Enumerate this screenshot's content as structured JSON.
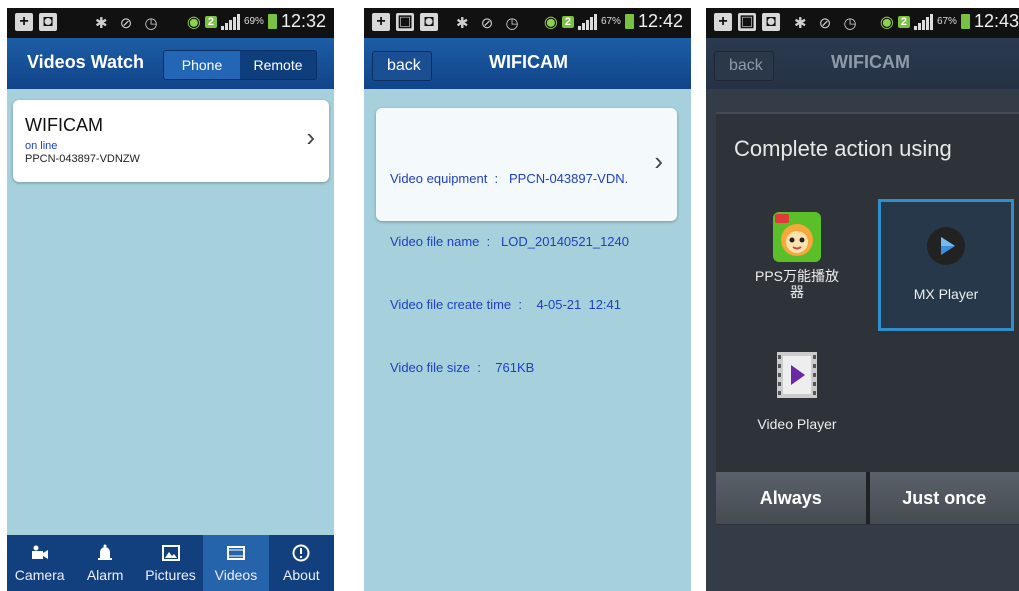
{
  "status": {
    "screen1": {
      "battery": "69%",
      "time": "12:32"
    },
    "screen2": {
      "battery": "67%",
      "time": "12:42"
    },
    "screen3": {
      "battery": "67%",
      "time": "12:43"
    },
    "sim": "2"
  },
  "screen1": {
    "title": "Videos Watch",
    "segments": [
      "Phone",
      "Remote"
    ],
    "active_segment": "Remote",
    "device": {
      "name": "WIFICAM",
      "status": "on line",
      "id": "PPCN-043897-VDNZW"
    },
    "tabs": [
      {
        "label": "Camera",
        "icon": "camera-icon"
      },
      {
        "label": "Alarm",
        "icon": "bell-icon"
      },
      {
        "label": "Pictures",
        "icon": "pictures-icon"
      },
      {
        "label": "Videos",
        "icon": "film-icon"
      },
      {
        "label": "About",
        "icon": "info-icon"
      }
    ],
    "active_tab": "Videos"
  },
  "screen2": {
    "back_label": "back",
    "title": "WIFICAM",
    "info": {
      "equipment": "Video equipment  :   PPCN-043897-VDN.",
      "file_name": "Video file name  :   LOD_20140521_1240",
      "create_time": "Video file create time  :    4-05-21  12:41",
      "size": "Video file size  :    761KB"
    }
  },
  "screen3": {
    "back_label": "back",
    "title": "WIFICAM",
    "dialog_title": "Complete action using",
    "apps": [
      {
        "label": "PPS万能播放器",
        "icon": "pps-icon"
      },
      {
        "label": "MX Player",
        "icon": "mx-player-icon"
      },
      {
        "label": "Video Player",
        "icon": "video-player-icon"
      }
    ],
    "selected_app": "MX Player",
    "buttons": {
      "always": "Always",
      "just_once": "Just once"
    }
  },
  "colors": {
    "titlebar": "#1a5298",
    "content_bg": "#a6d1dc",
    "tabbar": "#12407f",
    "dialog": "#2d3339",
    "selection": "#2f8fcc"
  }
}
